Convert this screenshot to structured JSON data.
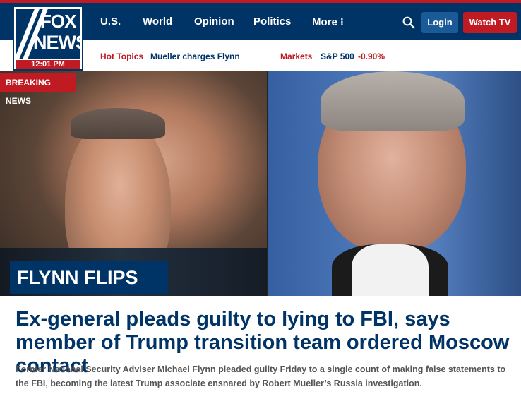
{
  "header": {
    "nav_items": [
      "U.S.",
      "World",
      "Opinion",
      "Politics",
      "More ⁝"
    ],
    "logo": {
      "line1": "FOX",
      "line2": "NEWS",
      "time": "12:01 PM"
    },
    "login_label": "Login",
    "watch_label": "Watch TV"
  },
  "subnav": {
    "hot_topics": "Hot Topics",
    "mueller": "Mueller charges Flynn",
    "markets": "Markets",
    "sp500": "S&P 500",
    "sp500_change": "-0.90%"
  },
  "hero": {
    "badge": "BREAKING NEWS",
    "overlay_title": "FLYNN FLIPS"
  },
  "article": {
    "headline": "Ex-general pleads guilty to lying to FBI, says member of Trump transition team ordered Moscow contact",
    "summary": "Former National Security Adviser Michael Flynn pleaded guilty Friday to a single count of making false statements to the FBI, becoming the latest Trump associate ensnared by Robert Mueller’s Russia investigation."
  },
  "colors": {
    "brand_navy": "#003366",
    "brand_red": "#c01b22",
    "login_blue": "#1a5a96"
  },
  "icons": {
    "search": "search-icon",
    "more": "more-vertical-icon"
  }
}
